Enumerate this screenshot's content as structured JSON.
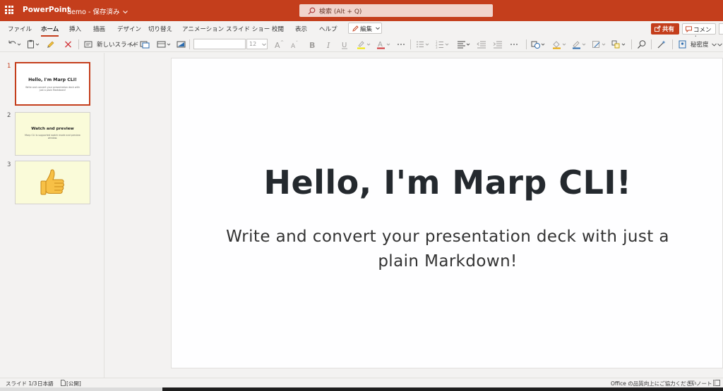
{
  "titlebar": {
    "app_name": "PowerPoint",
    "doc_name": "demo",
    "save_status": "保存済み",
    "search_placeholder": "検索 (Alt + Q)",
    "accent_color": "#c43e1c"
  },
  "ribbon": {
    "tabs": [
      {
        "label": "ファイル",
        "active": false
      },
      {
        "label": "ホーム",
        "active": true
      },
      {
        "label": "挿入",
        "active": false
      },
      {
        "label": "描画",
        "active": false
      },
      {
        "label": "デザイン",
        "active": false
      },
      {
        "label": "切り替え",
        "active": false
      },
      {
        "label": "アニメーション",
        "active": false
      },
      {
        "label": "スライド ショー",
        "active": false
      },
      {
        "label": "校閲",
        "active": false
      },
      {
        "label": "表示",
        "active": false
      },
      {
        "label": "ヘルプ",
        "active": false
      }
    ],
    "edit_mode_label": "編集",
    "share_label": "共有",
    "comment_label": "コメント"
  },
  "toolbar": {
    "new_slide_label": "新しいスライド",
    "font_name_value": "",
    "font_size_value": "12",
    "sensitivity_label": "秘密度",
    "icons": [
      "undo-icon",
      "paste-icon",
      "format-painter-icon",
      "clear-icon",
      "new-slide-icon",
      "reuse-slide-icon",
      "layout-icon",
      "background-icon",
      "grow-font-icon",
      "shrink-font-icon",
      "bold-icon",
      "italic-icon",
      "underline-icon",
      "highlight-icon",
      "font-color-icon",
      "more-icon",
      "bullets-icon",
      "numbering-icon",
      "align-icon",
      "decrease-indent-icon",
      "increase-indent-icon",
      "shapes-icon",
      "shape-fill-icon",
      "shape-outline-icon",
      "shape-effects-icon",
      "arrange-icon",
      "find-icon",
      "designer-icon",
      "sensitivity-icon"
    ]
  },
  "slides_panel": {
    "slides": [
      {
        "number": "1",
        "title": "Hello, I'm Marp CLI!",
        "subtitle": "Write and convert your presentation deck with just a plain Markdown!",
        "selected": true,
        "background": "#ffffff"
      },
      {
        "number": "2",
        "title": "Watch and preview",
        "subtitle": "Marp CLI is supported watch mode and preview window.",
        "selected": false,
        "background": "#fafbd9"
      },
      {
        "number": "3",
        "title": "",
        "subtitle": "",
        "selected": false,
        "background": "#fafbd9",
        "content_icon": "thumbs-up-emoji"
      }
    ]
  },
  "current_slide": {
    "title": "Hello, I'm Marp CLI!",
    "subtitle_line1": "Write and convert your presentation deck with just a",
    "subtitle_line2": "plain Markdown!"
  },
  "statusbar": {
    "slide_indicator": "スライド 1/3",
    "language": "日本語",
    "sensitivity_tag": "[公開]",
    "feedback": "Office の品質向上にご協力ください",
    "notes_label": "ノート"
  }
}
